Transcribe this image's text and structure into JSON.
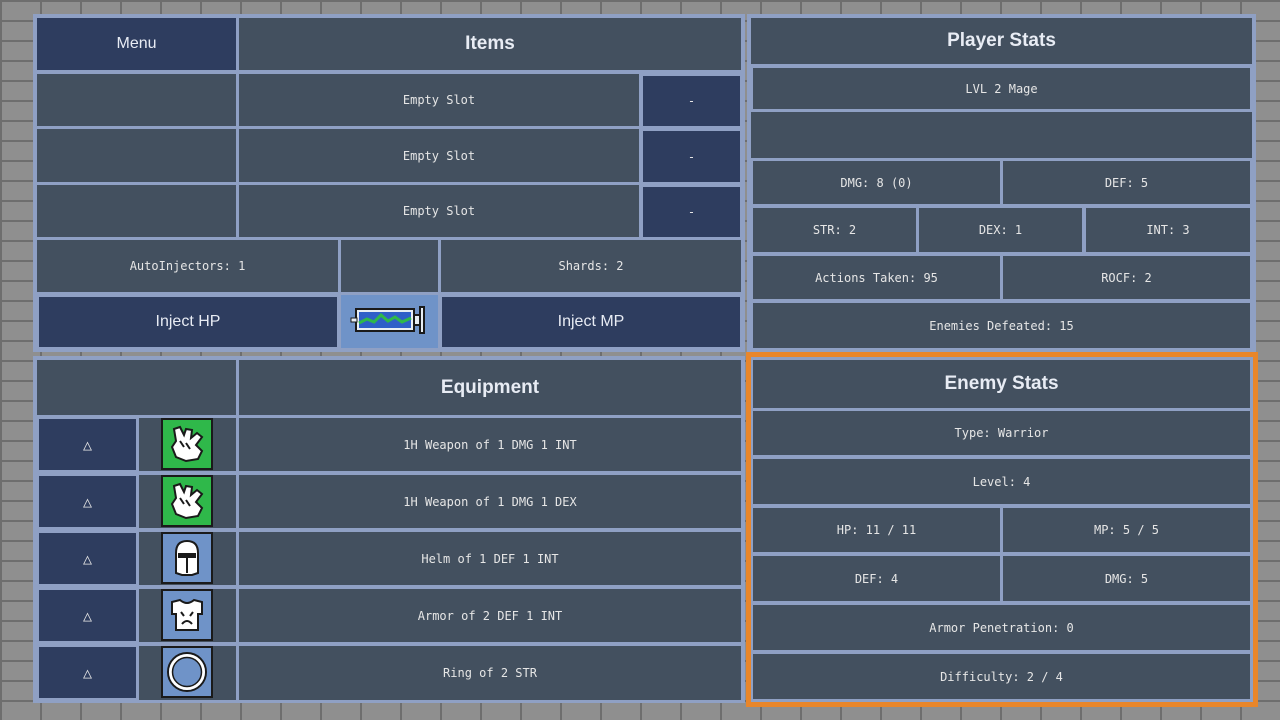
{
  "items_panel": {
    "menu_label": "Menu",
    "title": "Items",
    "slots": [
      {
        "label": "Empty Slot",
        "action": "-"
      },
      {
        "label": "Empty Slot",
        "action": "-"
      },
      {
        "label": "Empty Slot",
        "action": "-"
      }
    ],
    "autoinjectors": "AutoInjectors: 1",
    "shards": "Shards: 2",
    "inject_hp_label": "Inject HP",
    "inject_mp_label": "Inject MP",
    "injector_icon": "syringe-icon"
  },
  "player_stats": {
    "title": "Player Stats",
    "level": "LVL 2 Mage",
    "dmg": "DMG: 8 (0)",
    "def": "DEF: 5",
    "str": "STR: 2",
    "dex": "DEX: 1",
    "int": "INT: 3",
    "actions": "Actions Taken: 95",
    "rocf": "ROCF: 2",
    "enemies_defeated": "Enemies Defeated: 15"
  },
  "equipment": {
    "title": "Equipment",
    "items": [
      {
        "button": "△",
        "label": "1H Weapon of 1 DMG 1 INT",
        "icon": "gauntlet-icon",
        "icon_color": "#2fb84a"
      },
      {
        "button": "△",
        "label": "1H Weapon of 1 DMG 1 DEX",
        "icon": "gauntlet-icon",
        "icon_color": "#2fb84a"
      },
      {
        "button": "△",
        "label": "Helm of 1 DEF 1 INT",
        "icon": "helmet-icon",
        "icon_color": "#6f93c8"
      },
      {
        "button": "△",
        "label": "Armor of 2 DEF 1 INT",
        "icon": "armor-icon",
        "icon_color": "#6f93c8"
      },
      {
        "button": "△",
        "label": "Ring of 2 STR",
        "icon": "ring-icon",
        "icon_color": "#6f93c8"
      }
    ]
  },
  "enemy_stats": {
    "title": "Enemy Stats",
    "type": "Type: Warrior",
    "level": "Level: 4",
    "hp": "HP: 11 / 11",
    "mp": "MP: 5 / 5",
    "def": "DEF: 4",
    "dmg": "DMG: 5",
    "armor_pen": "Armor Penetration: 0",
    "difficulty": "Difficulty: 2 / 4",
    "highlight_color": "#e8862b"
  }
}
